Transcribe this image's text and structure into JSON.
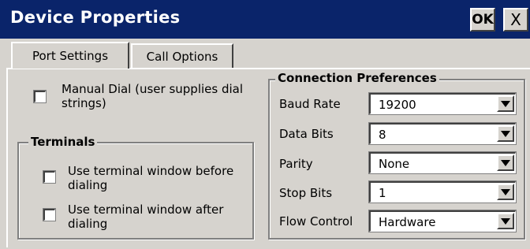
{
  "window": {
    "title": "Device Properties",
    "ok_label": "OK",
    "close_label": "X"
  },
  "tabs": [
    {
      "label": "Port Settings",
      "active": true
    },
    {
      "label": "Call Options",
      "active": false
    }
  ],
  "manual_dial": {
    "label": "Manual Dial (user supplies dial strings)",
    "checked": false
  },
  "terminals": {
    "title": "Terminals",
    "before": {
      "label": "Use terminal window before dialing",
      "checked": false
    },
    "after": {
      "label": "Use terminal window after dialing",
      "checked": false
    }
  },
  "connection": {
    "title": "Connection Preferences",
    "rows": [
      {
        "label": "Baud Rate",
        "value": "19200"
      },
      {
        "label": "Data Bits",
        "value": "8"
      },
      {
        "label": "Parity",
        "value": "None"
      },
      {
        "label": "Stop Bits",
        "value": "1"
      },
      {
        "label": "Flow Control",
        "value": "Hardware"
      }
    ]
  },
  "colors": {
    "titlebar": "#0a246a",
    "face": "#d6d3ce"
  }
}
